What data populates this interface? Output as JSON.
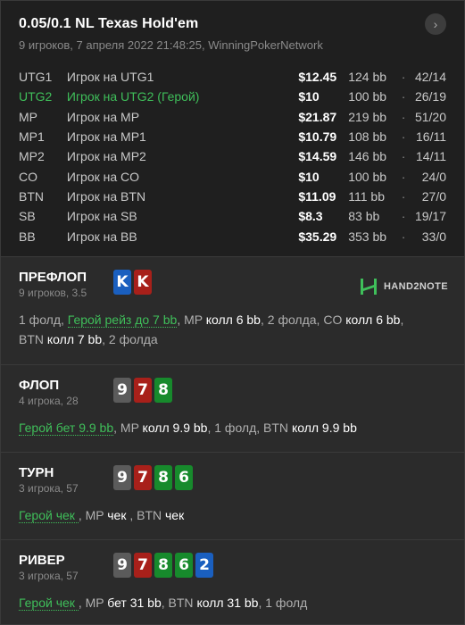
{
  "header": {
    "title": "0.05/0.1 NL Texas Hold'em",
    "subtitle": "9 игроков, 7 апреля 2022 21:48:25, WinningPokerNetwork",
    "nav_icon": "chevron-right-icon"
  },
  "players": [
    {
      "pos": "UTG1",
      "name": "Игрок на UTG1",
      "stack": "$12.45",
      "bb": "124 bb",
      "stats": "42/14",
      "hero": false
    },
    {
      "pos": "UTG2",
      "name": "Игрок на UTG2 (Герой)",
      "stack": "$10",
      "bb": "100 bb",
      "stats": "26/19",
      "hero": true
    },
    {
      "pos": "MP",
      "name": "Игрок на MP",
      "stack": "$21.87",
      "bb": "219 bb",
      "stats": "51/20",
      "hero": false
    },
    {
      "pos": "MP1",
      "name": "Игрок на MP1",
      "stack": "$10.79",
      "bb": "108 bb",
      "stats": "16/11",
      "hero": false
    },
    {
      "pos": "MP2",
      "name": "Игрок на MP2",
      "stack": "$14.59",
      "bb": "146 bb",
      "stats": "14/11",
      "hero": false
    },
    {
      "pos": "CO",
      "name": "Игрок на CO",
      "stack": "$10",
      "bb": "100 bb",
      "stats": "24/0",
      "hero": false
    },
    {
      "pos": "BTN",
      "name": "Игрок на BTN",
      "stack": "$11.09",
      "bb": "111 bb",
      "stats": "27/0",
      "hero": false
    },
    {
      "pos": "SB",
      "name": "Игрок на SB",
      "stack": "$8.3",
      "bb": "83 bb",
      "stats": "19/17",
      "hero": false
    },
    {
      "pos": "BB",
      "name": "Игрок на BB",
      "stack": "$35.29",
      "bb": "353 bb",
      "stats": "33/0",
      "hero": false
    }
  ],
  "separator": "·",
  "logo_text": "HAND2NOTE",
  "colors": {
    "hero": "#3fbf5a",
    "spades": "#5b5b5b",
    "hearts": "#a8201a",
    "clubs": "#178a2c",
    "diamonds": "#1a5fbf"
  },
  "preflop": {
    "name": "ПРЕФЛОП",
    "sub": "9 игроков, 3.5",
    "cards": [
      {
        "rank": "K",
        "suit": "d"
      },
      {
        "rank": "K",
        "suit": "h"
      }
    ],
    "line1": {
      "a": "1 фолд, ",
      "b": "Герой рейз до 7 bb",
      "c": ", MP ",
      "d": "колл 6 bb",
      "e": ", 2 фолда, CO ",
      "f": "колл 6 bb",
      "g": ","
    },
    "line2": {
      "a": "BTN ",
      "b": "колл 7 bb",
      "c": ", 2 фолда"
    }
  },
  "flop": {
    "name": "ФЛОП",
    "sub": "4 игрока, 28",
    "cards": [
      {
        "rank": "9",
        "suit": "s"
      },
      {
        "rank": "7",
        "suit": "h"
      },
      {
        "rank": "8",
        "suit": "c"
      }
    ],
    "line": {
      "a": "Герой бет 9.9 bb",
      "b": ", MP ",
      "c": "колл 9.9 bb",
      "d": ", 1 фолд, BTN ",
      "e": "колл 9.9 bb"
    }
  },
  "turn": {
    "name": "ТУРН",
    "sub": "3 игрока, 57",
    "cards": [
      {
        "rank": "9",
        "suit": "s"
      },
      {
        "rank": "7",
        "suit": "h"
      },
      {
        "rank": "8",
        "suit": "c"
      },
      {
        "rank": "6",
        "suit": "c"
      }
    ],
    "line": {
      "a": "Герой чек ",
      "b": ", MP ",
      "c": "чек ",
      "d": ", BTN ",
      "e": "чек"
    }
  },
  "river": {
    "name": "РИВЕР",
    "sub": "3 игрока, 57",
    "cards": [
      {
        "rank": "9",
        "suit": "s"
      },
      {
        "rank": "7",
        "suit": "h"
      },
      {
        "rank": "8",
        "suit": "c"
      },
      {
        "rank": "6",
        "suit": "c"
      },
      {
        "rank": "2",
        "suit": "d"
      }
    ],
    "line": {
      "a": "Герой чек ",
      "b": ", MP ",
      "c": "бет 31 bb",
      "d": ", BTN ",
      "e": "колл 31 bb",
      "f": ", 1 фолд"
    }
  }
}
